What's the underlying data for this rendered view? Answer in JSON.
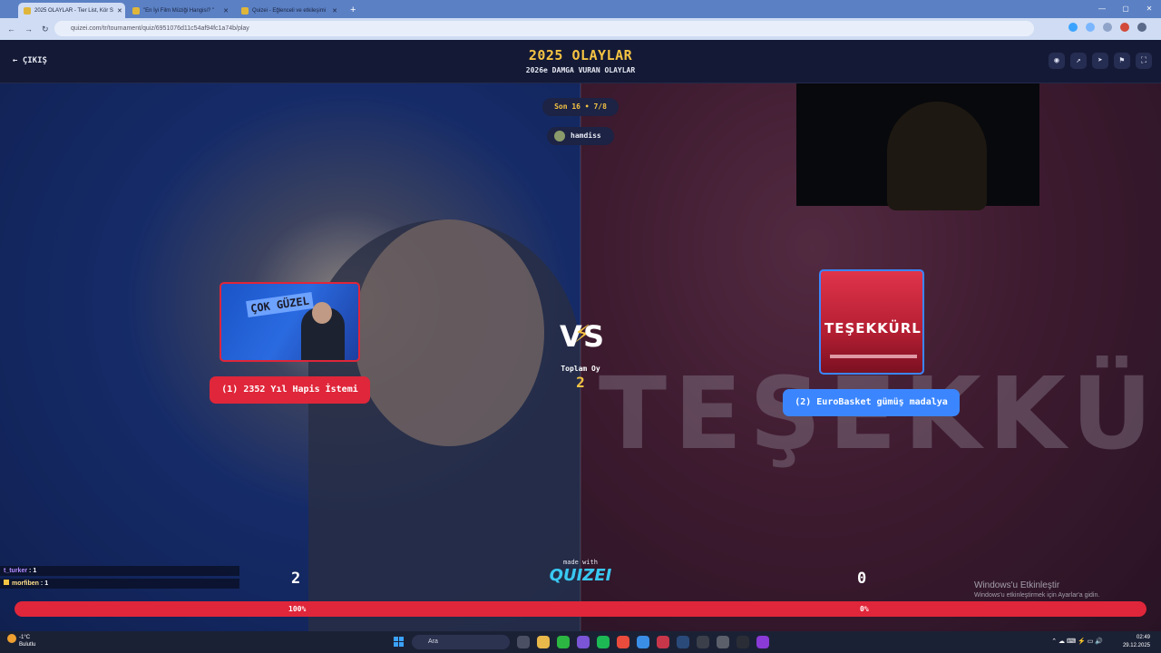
{
  "browser": {
    "tabs": [
      {
        "title": "2025 OLAYLAR - Tier List, Kör S"
      },
      {
        "title": "\"En İyi Film Müziği Hangisi? \""
      },
      {
        "title": "Quizei - Eğlenceli ve etkileşimi"
      }
    ],
    "new_tab": "+",
    "url": "quizei.com/tr/tournament/quiz/6951076d11c54af94fc1a74b/play",
    "window_controls": {
      "minimize": "—",
      "maximize": "▢",
      "close": "✕"
    }
  },
  "header": {
    "exit_label": "ÇIKIŞ",
    "title": "2025 OLAYLAR",
    "subtitle": "2026e DAMGA VURAN OLAYLAR",
    "icons": [
      "eye-icon",
      "external-link-icon",
      "send-icon",
      "flag-icon",
      "fullscreen-icon"
    ]
  },
  "match": {
    "round": "Son 16 • 7/8",
    "user": "hamdiss",
    "vs_left": "V",
    "vs_right": "S",
    "total_label": "Toplam Oy",
    "total_value": "2",
    "left": {
      "label": "(1) 2352 Yıl Hapis İstemi",
      "poster_text": "ÇOK GÜZEL",
      "votes": "2",
      "percent_text": "100%",
      "percent": 100,
      "color": "#e0263a"
    },
    "right": {
      "label": "(2) EuroBasket gümüş madalya",
      "image_text": "TEŞEKKÜRLER",
      "background_text": "TEŞEKKÜRLER",
      "votes": "0",
      "percent_text": "0%",
      "percent": 0,
      "color": "#3b86ff"
    }
  },
  "branding": {
    "made_with": "made with",
    "logo": "QUIZEI"
  },
  "chat": [
    {
      "user": "t_turker",
      "value": "1"
    },
    {
      "user": "morfiben",
      "value": "1"
    }
  ],
  "watermark": {
    "line1": "Windows'u Etkinleştir",
    "line2": "Windows'u etkinleştirmek için Ayarlar'a gidin."
  },
  "taskbar": {
    "temperature": "-1°C",
    "weather": "Bulutlu",
    "search_placeholder": "Ara",
    "time": "02:49",
    "date": "29.12.2025"
  },
  "colors": {
    "accent": "#f6c443",
    "left_option": "#e0263a",
    "right_option": "#3b86ff",
    "header_bg": "#141a36"
  }
}
